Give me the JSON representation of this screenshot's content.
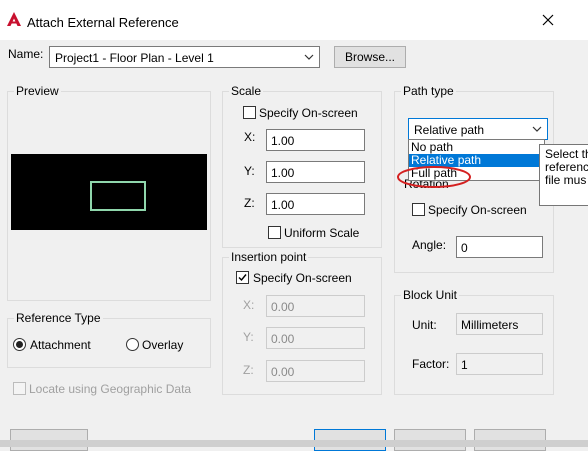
{
  "window": {
    "title": "Attach External Reference"
  },
  "name": {
    "label": "Name:",
    "value": "Project1 - Floor Plan - Level 1",
    "browse_label": "Browse..."
  },
  "preview": {
    "title": "Preview"
  },
  "reference_type": {
    "title": "Reference Type",
    "attachment_label": "Attachment",
    "overlay_label": "Overlay",
    "selected": "Attachment"
  },
  "geo": {
    "label": "Locate using Geographic Data"
  },
  "scale": {
    "title": "Scale",
    "specify_label": "Specify On-screen",
    "x_label": "X:",
    "x_value": "1.00",
    "y_label": "Y:",
    "y_value": "1.00",
    "z_label": "Z:",
    "z_value": "1.00",
    "uniform_label": "Uniform Scale"
  },
  "insertion": {
    "title": "Insertion point",
    "specify_label": "Specify On-screen",
    "x_label": "X:",
    "x_value": "0.00",
    "y_label": "Y:",
    "y_value": "0.00",
    "z_label": "Z:",
    "z_value": "0.00"
  },
  "path_type": {
    "title": "Path type",
    "selected": "Relative path",
    "options": [
      "No path",
      "Relative path",
      "Full path"
    ],
    "tooltip_lines": [
      "Select th",
      "referenc",
      "file mus"
    ]
  },
  "rotation": {
    "title": "Rotation",
    "specify_label": "Specify On-screen",
    "angle_label": "Angle:",
    "angle_value": "0"
  },
  "block_unit": {
    "title": "Block Unit",
    "unit_label": "Unit:",
    "unit_value": "Millimeters",
    "factor_label": "Factor:",
    "factor_value": "1"
  },
  "colors": {
    "accent": "#0078d7",
    "preview_rect": "#8fd6ac",
    "annotation": "#d42020",
    "app_icon": "#c8102e"
  }
}
